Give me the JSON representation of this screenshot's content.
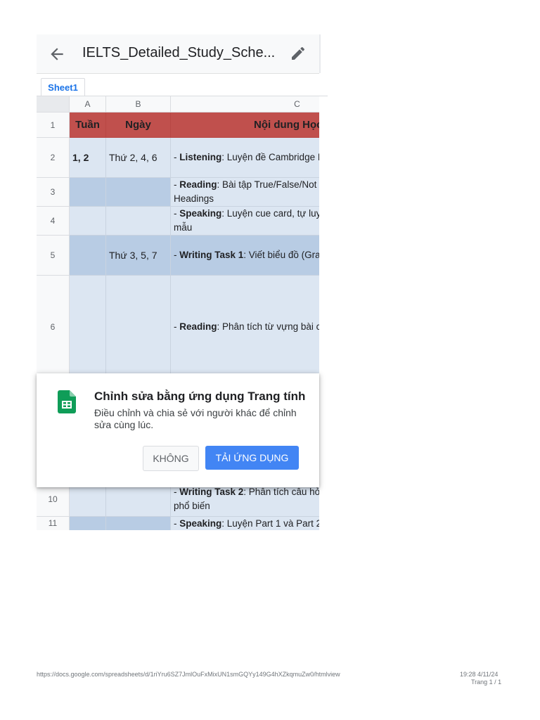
{
  "app_bar": {
    "title": "IELTS_Detailed_Study_Sche...",
    "back_icon": "arrow-left-icon",
    "edit_icon": "pencil-icon"
  },
  "sheet_tab": {
    "label": "Sheet1"
  },
  "grid": {
    "columns": [
      "A",
      "B",
      "C"
    ],
    "rows": [
      {
        "num": "1",
        "a": "Tuần",
        "b": "Ngày",
        "c_plain": "Nội dung Học"
      },
      {
        "num": "2",
        "a": "1, 2",
        "b": "Thứ 2, 4, 6",
        "c_prefix": "- ",
        "c_bold": "Listening",
        "c_text": ": Luyện đề Cambridge L"
      },
      {
        "num": "3",
        "a": "",
        "b": "",
        "c_prefix": "- ",
        "c_bold": "Reading",
        "c_text": ": Bài tập True/False/Not",
        "c_line2": "Headings"
      },
      {
        "num": "4",
        "a": "",
        "b": "",
        "c_prefix": "- ",
        "c_bold": "Speaking",
        "c_text": ": Luyện cue card, tự luy",
        "c_line2": "mẫu"
      },
      {
        "num": "5",
        "a": "",
        "b": "Thứ 3, 5, 7",
        "c_prefix": "- ",
        "c_bold": "Writing Task 1",
        "c_text": ": Viết biểu đồ (Gra"
      },
      {
        "num": "6",
        "a": "",
        "b": "",
        "c_prefix": "- ",
        "c_bold": "Reading",
        "c_text": ": Phân tích từ vựng bài c"
      },
      {
        "num": "10",
        "a": "",
        "b": "",
        "c_prefix": "- ",
        "c_bold": "Writing Task 2",
        "c_text": ": Phân tích câu hỏ",
        "c_line2": "phổ biến"
      },
      {
        "num": "11",
        "a": "",
        "b": "",
        "c_prefix": "- ",
        "c_bold": "Speaking",
        "c_text": ": Luyện Part 1 và Part 2"
      }
    ]
  },
  "dialog": {
    "icon": "google-sheets-icon",
    "title": "Chỉnh sửa bằng ứng dụng Trang tính",
    "body": "Điều chỉnh và chia sẻ với người khác để chỉnh sửa cùng lúc.",
    "cancel_label": "KHÔNG",
    "confirm_label": "TẢI ỨNG DỤNG"
  },
  "footer": {
    "url": "https://docs.google.com/spreadsheets/d/1riYru6SZ7JmlOuFxMixUN1smGQYy149G4hXZkqmuZw0/htmlview",
    "timestamp": "19:28 4/11/24",
    "page": "Trang 1 / 1"
  },
  "colors": {
    "header_row": "#c0504d",
    "band_light": "#dce6f2",
    "band_dark": "#b8cce4",
    "accent": "#4285f4",
    "sheets_green": "#0f9d58"
  }
}
